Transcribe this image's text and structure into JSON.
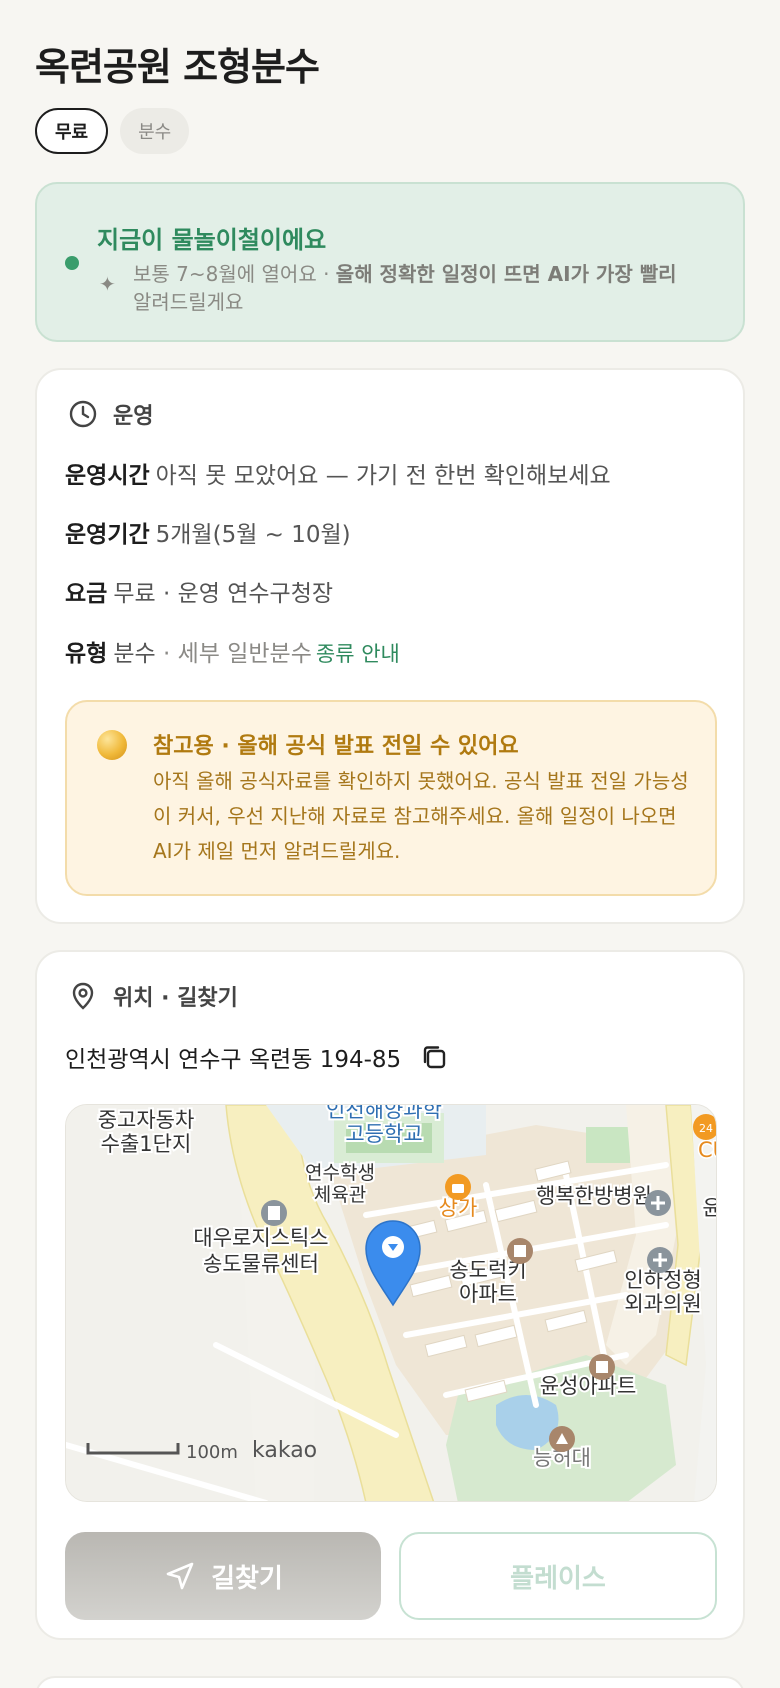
{
  "title": "옥련공원 조형분수",
  "chips": [
    {
      "label": "무료"
    },
    {
      "label": "분수"
    }
  ],
  "season": {
    "headline": "지금이 물놀이철이에요",
    "sparkle": "✦",
    "desc_light": "보통 7~8월에 열어요 · ",
    "desc_bold": "올해 정확한 일정이 뜨면 AI가 가장 빨리",
    "desc_tail": "알려드릴게요",
    "accent": "#2f8a5e"
  },
  "ops": {
    "heading": "운영",
    "hours_label": "운영시간",
    "hours_value": "아직 못 모았어요 — 가기 전 한번 확인해보세요",
    "period_label": "운영기간",
    "period_value": "5개월(5월 ~ 10월)",
    "fee_label": "요금",
    "fee_value": "무료 · 운영 연수구청장",
    "type_label": "유형",
    "type_value": "분수",
    "type_detail": " · 세부 일반분수",
    "type_link": "종류 안내"
  },
  "notice": {
    "title": "참고용 · 올해 공식 발표 전일 수 있어요",
    "body": "아직 올해 공식자료를 확인하지 못했어요. 공식 발표 전일 가능성이 커서, 우선 지난해 자료로 참고해주세요. 올해 일정이 나오면 AI가 제일 먼저 알려드릴게요.",
    "color": "#b07a10"
  },
  "location": {
    "heading": "위치 · 길찾기",
    "address": "인천광역시 연수구 옥련동 194-85",
    "map": {
      "labels": {
        "used_car_1": "중고자동차",
        "used_car_2": "수출1단지",
        "school_1": "인천해양과학",
        "school_2": "고등학교",
        "gym_1": "연수학생",
        "gym_2": "체육관",
        "shop": "상가",
        "clinic": "행복한방병원",
        "logistics_1": "대우로지스틱스",
        "logistics_2": "송도물류센터",
        "apt1_1": "송도럭키",
        "apt1_2": "아파트",
        "ortho_1": "인하정형",
        "ortho_2": "외과의원",
        "apt2": "윤성아파트",
        "hill": "능허대",
        "cu": "CU",
        "num24": "24",
        "edge": "윤",
        "scale": "100m",
        "brand": "kakao"
      }
    }
  },
  "buttons": {
    "nav": "길찾기",
    "place": "플레이스"
  }
}
